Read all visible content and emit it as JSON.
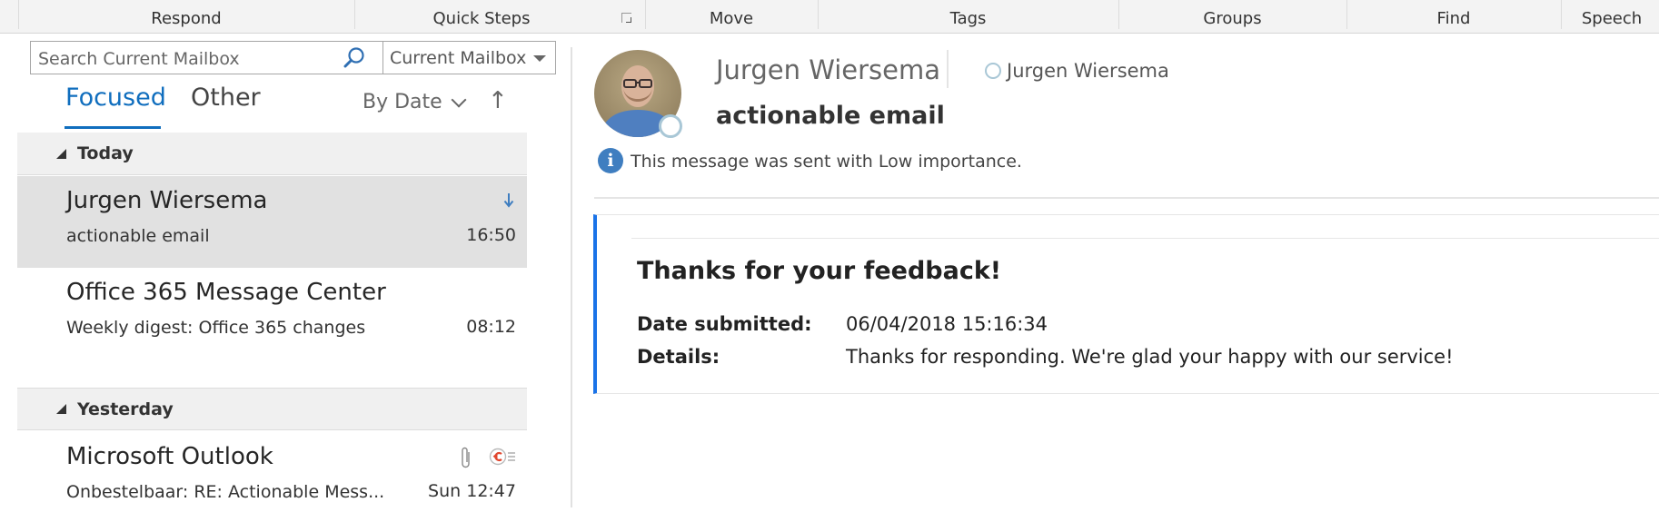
{
  "ribbon": {
    "groups": [
      "Respond",
      "Quick Steps",
      "Move",
      "Tags",
      "Groups",
      "Find",
      "Speech"
    ]
  },
  "search": {
    "placeholder": "Search Current Mailbox",
    "scope_selected": "Current Mailbox"
  },
  "tabs": {
    "focused": "Focused",
    "other": "Other",
    "active": "Focused"
  },
  "sort": {
    "label": "By Date",
    "direction_icon": "↑"
  },
  "mail_list": {
    "groups": [
      {
        "label": "Today",
        "items": [
          {
            "sender": "Jurgen Wiersema",
            "subject": "actionable email",
            "time": "16:50",
            "selected": true,
            "low_importance": true
          },
          {
            "sender": "Office 365 Message Center",
            "subject": "Weekly digest: Office 365 changes",
            "time": "08:12"
          }
        ]
      },
      {
        "label": "Yesterday",
        "items": [
          {
            "sender": "Microsoft Outlook",
            "subject": "Onbestelbaar: RE: Actionable Mess...",
            "time": "Sun 12:47",
            "has_attachment": true,
            "forwarded": true
          }
        ]
      }
    ]
  },
  "reading_pane": {
    "sender": "Jurgen Wiersema",
    "to": "Jurgen Wiersema",
    "subject": "actionable email",
    "info": "This message was sent with Low importance.",
    "card": {
      "title": "Thanks for your feedback!",
      "facts": [
        {
          "label": "Date submitted:",
          "value": "06/04/2018 15:16:34"
        },
        {
          "label": "Details:",
          "value": "Thanks for responding. We're glad your happy with our service!"
        }
      ]
    }
  },
  "colors": {
    "accent": "#106ebe",
    "card_border": "#1a73e8",
    "selected_row": "#e1e1e1",
    "group_header": "#f0f0f0"
  }
}
